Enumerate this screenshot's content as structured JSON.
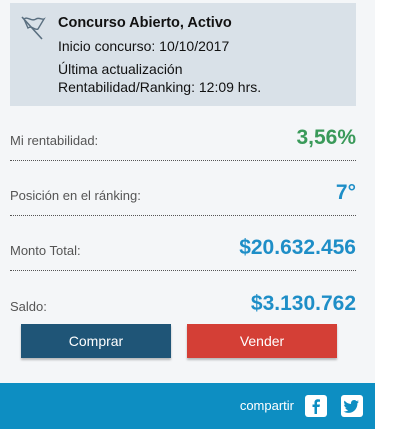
{
  "header": {
    "title": "Concurso Abierto, Activo",
    "start": "Inicio concurso: 10/10/2017",
    "update_line1": "Última actualización",
    "update_line2": "Rentabilidad/Ranking: 12:09 hrs."
  },
  "stats": [
    {
      "label": "Mi rentabilidad:",
      "value": "3,56%",
      "color": "#3a9a5a"
    },
    {
      "label": "Posición en el ránking:",
      "value": "7°",
      "color": "#1e8ec7"
    },
    {
      "label": "Monto Total:",
      "value": "$20.632.456",
      "color": "#1e8ec7"
    },
    {
      "label": "Saldo:",
      "value": "$3.130.762",
      "color": "#1e8ec7"
    }
  ],
  "actions": {
    "buy_label": "Comprar",
    "sell_label": "Vender",
    "buy_color": "#1f5577",
    "sell_color": "#d43f36"
  },
  "footer": {
    "share_label": "compartir",
    "bg_color": "#0d8ec2",
    "icons": [
      "facebook-icon",
      "twitter-icon"
    ]
  }
}
